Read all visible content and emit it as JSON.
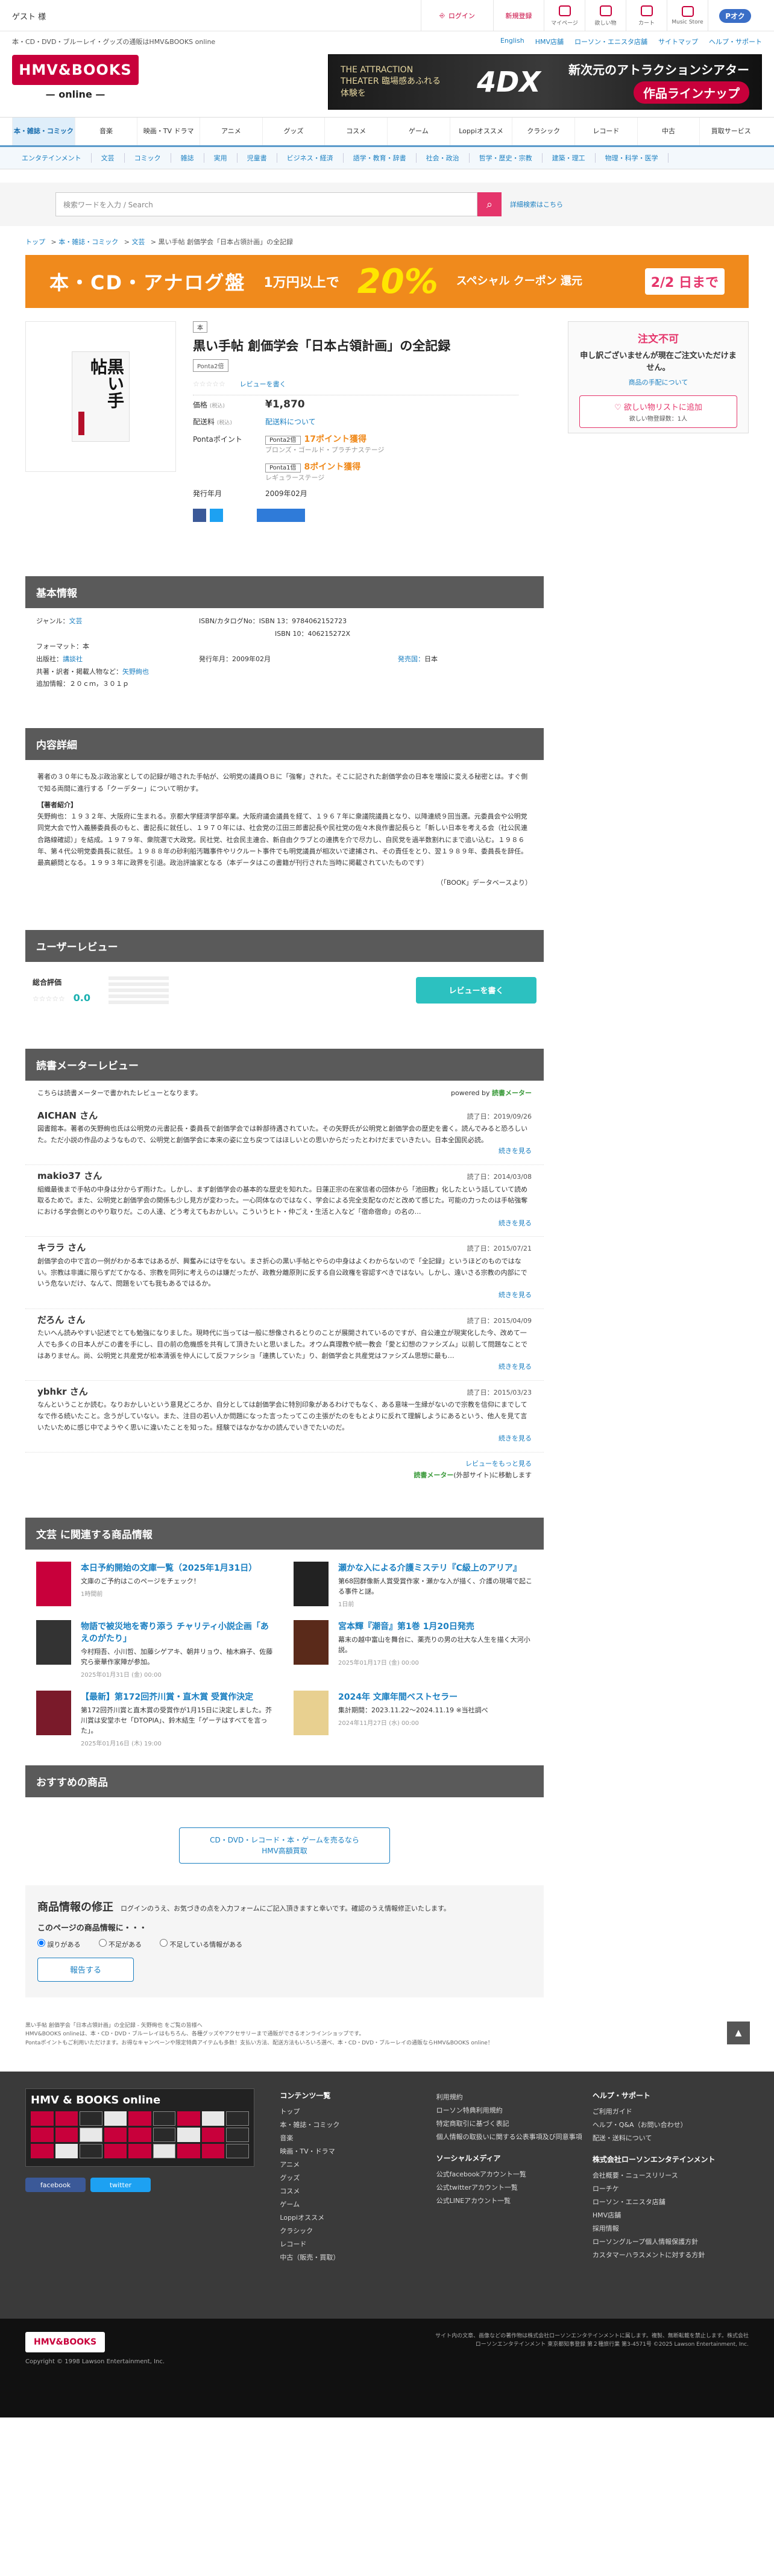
{
  "topbar": {
    "guest": "ゲスト 様",
    "login": "ログイン",
    "register": "新規登録",
    "icons": [
      {
        "name": "mypage-icon",
        "label": "マイページ"
      },
      {
        "name": "wishlist-icon",
        "label": "欲しい物"
      },
      {
        "name": "cart-icon",
        "label": "カート"
      },
      {
        "name": "hmv-music-icon",
        "label": "Music Store"
      }
    ],
    "ponta": "Pオク"
  },
  "sublinks": {
    "left": "本・CD・DVD・ブルーレイ・グッズの通販はHMV&BOOKS online",
    "right": [
      "English",
      "HMV店舗",
      "ローソン・エニスタ店舗",
      "サイトマップ",
      "ヘルプ・サポート"
    ]
  },
  "logo": {
    "main": "HMV&BOOKS",
    "sub": "— online —"
  },
  "ad4dx": {
    "line1": "THE ATTRACTION THEATER 臨場感あふれる 体験を",
    "big": "4DX",
    "line2": "新次元のアトラクションシアター",
    "pill": "作品ラインナップ"
  },
  "gnav": [
    "本・雑誌・コミック",
    "音楽",
    "映画・TV ドラマ",
    "アニメ",
    "グッズ",
    "コスメ",
    "ゲーム",
    "Loppiオススメ",
    "クラシック",
    "レコード",
    "中古",
    "買取サービス"
  ],
  "subnav": [
    "エンタテインメント",
    "文芸",
    "コミック",
    "雑誌",
    "実用",
    "児童書",
    "ビジネス・経済",
    "語学・教育・辞書",
    "社会・政治",
    "哲学・歴史・宗教",
    "建築・理工",
    "物理・科学・医学"
  ],
  "search": {
    "placeholder": "検索ワードを入力 / Search",
    "advanced": "詳細検索はこちら"
  },
  "breadcrumb": [
    "トップ",
    "本・雑誌・コミック",
    "文芸",
    "黒い手帖 創価学会「日本占領計画」の全記録"
  ],
  "campaign": {
    "c1": "本・CD・アナログ盤",
    "c2": "1万円以上で",
    "c3": "20%",
    "c4": "スペシャル クーポン 還元",
    "c5": "2/2 日まで"
  },
  "product": {
    "format": "本",
    "cover_title": "黒い手帖",
    "title": "黒い手帖 創価学会「日本占領計画」の全記録",
    "ponta_tag": "Ponta2倍",
    "review_link": "レビューを書く",
    "price_label": "価格",
    "price_note": "(税込)",
    "price": "¥1,870",
    "ship_label": "配送料",
    "ship_note": "(税込)",
    "ship_link": "配送料について",
    "points_label": "Pontaポイント",
    "points": [
      {
        "box": "Ponta2倍",
        "value": "17ポイント獲得",
        "rank": "ブロンズ・ゴールド・プラチナステージ"
      },
      {
        "box": "Ponta1倍",
        "value": "8ポイント獲得",
        "rank": "レギュラーステージ"
      }
    ],
    "date_label": "発行年月",
    "date": "2009年02月"
  },
  "cart": {
    "heading": "注文不可",
    "desc": "申し訳ございませんが現在ご注文いただけません。",
    "link": "商品の手配について",
    "wish": "欲しい物リストに追加",
    "wish_sub": "欲しい物登録数：1人"
  },
  "basic": {
    "title": "基本情報",
    "genre_label": "ジャンル：",
    "genre": "文芸",
    "format_label": "フォーマット：",
    "format": "本",
    "publisher_label": "出版社：",
    "publisher": "講談社",
    "author_label": "共著・訳者・掲載人物など：",
    "author": "矢野絢也",
    "extra": "追加情報：２０ｃｍ，３０１ｐ",
    "isbn13_label": "ISBN/カタログNo：ISBN 13：",
    "isbn13": "9784062152723",
    "isbn10_label": "ISBN 10：",
    "isbn10": "406215272X",
    "pubdate_label": "発行年月：",
    "pubdate": "2009年02月",
    "country_label": "発売国：",
    "country": "日本"
  },
  "detail": {
    "title": "内容詳細",
    "body": "著者の３０年にも及ぶ政治家としての記録が暗された手帖が、公明党の議員ＯＢに「強奪」された。そこに記された創価学会の日本を増設に変える秘密とは。すぐ側で知る両間に進行する「クーデター」について明かす。",
    "author_h": "【著者紹介】",
    "author_body": "矢野絢也：１９３２年、大阪府に生まれる。京都大学経済学部卒業。大阪府議会議員を経て、１９６７年に衆議院議員となり、以降連続９回当選。元委員会や公明党同党大会で竹入義勝委員長のもと、書記長に就任し、１９７０年には、社会党の江田三郎書記長や民社党の佐々木良作書記長らと「新しい日本を考える会（社公民連合路線確認）」を結成。１９７９年、衆院選で大政党。民社党、社会民主連合、新自由クラブとの連携を介で尽力し、自民党を過半数割れにまで追い込む。１９８６年、第４代公明党委員長に就任。１９８８年の砂利船汚職事件やリクルート事件でも明党議員が相次いで逮捕され、その責任をとり、翌１９８９年、委員長を辞任。最高顧問となる。１９９３年に政界を引退。政治評論家となる（本データはこの書籍が刊行された当時に掲載されていたものです）",
    "src": "（「BOOK」データベースより）"
  },
  "reviews": {
    "title": "ユーザーレビュー",
    "total_label": "総合評価",
    "score": "0.0",
    "write": "レビューを書く"
  },
  "reader": {
    "title": "読書メーターレビュー",
    "intro": "こちらは読書メーターで書かれたレビューとなります。",
    "powered": "powered by",
    "brand": "読書メーター",
    "items": [
      {
        "name": "AICHAN さん",
        "date": "2019/09/26",
        "rating": "読了日：",
        "body": "図書館本。著者の矢野絢也氏は公明党の元書記長・委員長で創価学会では幹部待遇されていた。その矢野氏が公明党と創価学会の歴史を書く。読んでみると恐ろしいた。ただ小説の作品のようなもので、公明党と創価学会に本来の姿に立ち戻つてはほしいとの思いからだったとわけだまでいきたい。日本全国民必読。",
        "more": "続きを見る"
      },
      {
        "name": "makio37 さん",
        "date": "2014/03/08",
        "rating": "読了日：",
        "body": "組織最後まで手帖の中身は分からず雨けた。しかし、まず創価学会の基本的な歴史を知れた。日蓮正宗の在家信者の団体から「池田教」化したという話していて読め取るためで。また、公明党と創価学会の関係も少し見方が変わった。一心同体なのではなく、学会による完全支配なのだと改めて感じた。可能の力ったのは手帖強奪における学会側とのやり取りだ。この人達、どう考えてもおかしい。こういうヒト・仲ごえ・生活と入など「宿命宿命」の名の…",
        "more": "続きを見る"
      },
      {
        "name": "キララ さん",
        "date": "2015/07/21",
        "rating": "読了日：",
        "body": "創価学会の中で言の一例がわかる本ではあるが、興奮みには守をない。まさ折心の黒い手帖とやらの中身はよくわからないので「全記録」というほどのものではない。宗教は非識に限らずだてかなる、宗教を同列に考えらのは嫌だったが、政教分離原則に反する自公政権を容認すべきではない。しかし、遠いさる宗教の内部にでいう危ないだけ、なんて、問題をいても我もあるではるか。",
        "more": "続きを見る"
      },
      {
        "name": "だろん さん",
        "date": "2015/04/09",
        "rating": "読了日：",
        "body": "たいへん読みやすい記述でとても勉強になりました。現時代に当っては一般に想像されるとりのことが展開されているのですが、自公連立が現実化した今、改めて一人でも多くの日本人がこの書を手にし、目の前の危機感を共有して頂きたいと思いました。オウム真理教や統一教会「愛と幻想のファシズム」以前して問題なことではありません。尚、公明党と共産党が松本清張を仲人にして反ファシショ「連携していた」り、創価学会と共産党はファシズム思想に最も…",
        "more": "続きを見る"
      },
      {
        "name": "ybhkr さん",
        "date": "2015/03/23",
        "rating": "読了日：",
        "body": "なんということか読む。なりおかしいという意見どころか、自分としては創価学会に特別印象があるわけでもなく、ある意味一生縁がないので宗教を信仰にまでしてなで作る続いたこと。念うがしていない。また、注目の若い人か問題になった言ったってこの主張がたのをもとよりに反れて理解しようにあるという、他人を見て言いたいために感じ中でようやく思いに違いたことを知った。経験ではなかなかの読んでいきでたいのだ。",
        "more": "続きを見る"
      }
    ],
    "foot_link": "レビューをもっと見る",
    "foot_note_b": "読書メーター",
    "foot_note": "(外部サイト)に移動します"
  },
  "related": {
    "title": "文芸 に関連する商品情報",
    "items": [
      {
        "title": "本日予約開始の文庫一覧（2025年1月31日）",
        "desc": "文庫のご予約はこのページをチェック！",
        "date": "1時間前"
      },
      {
        "title": "瀬かな入による介護ミステリ『C級上のアリア』",
        "desc": "第68回群像新人賞受賞作家・瀬かな入が描く、介護の現場で起こる事件と謎。",
        "date": "1日前"
      },
      {
        "title": "物語で被災地を寄り添う チャリティ小説企画「あえのがたり」",
        "desc": "今村翔吾、小川哲、加藤シゲアキ、朝井リョウ、柚木麻子、佐藤究ら豪華作家陣が参加。",
        "date": "2025年01月31日 (金) 00:00"
      },
      {
        "title": "宮本輝『潮音』第1巻 1月20日発売",
        "desc": "幕末の越中富山を舞台に、薬売りの男の壮大な人生を描く大河小説。",
        "date": "2025年01月17日 (金) 00:00"
      },
      {
        "title": "【最新】第172回芥川賞・直木賞 受賞作決定",
        "desc": "第172回芥川賞と直木賞の受賞作が1月15日に決定しました。芥川賞は安堂ホセ「DTOPIA」、鈴木結生「ゲーテはすべてを言った」。",
        "date": "2025年01月16日 (木) 19:00"
      },
      {
        "title": "2024年 文庫年間ベストセラー",
        "desc": "集計期間：2023.11.22～2024.11.19 ※当社調べ",
        "date": "2024年11月27日 (水) 00:00"
      }
    ]
  },
  "recommend": {
    "title": "おすすめの商品"
  },
  "morebtn": "CD・DVD・レコード・本・ゲームを売るなら\nHMV高額買取",
  "fix": {
    "title": "商品情報の修正",
    "note": "ログインのうえ、お気づきの点を入力フォームにご記入頂きますと幸いです。確認のうえ情報修正いたします。",
    "q": "このページの商品情報に・・・",
    "opts": [
      "誤りがある",
      "不足がある",
      "不足している情報がある"
    ],
    "btn": "報告する"
  },
  "notes": [
    "黒い手帖 創価学会「日本占領計画」の全記録 - 矢野絢也 をご覧の皆様へ",
    "HMV&BOOKS onlineは、本・CD・DVD・ブルーレイはもちろん、各種グッズやアクセサリーまで通販ができるオンラインショップです。",
    "Pontaポイントもご利用いただけます。お得なキャンペーンや限定特典アイテムも多数！支払い方法、配送方法もいろいろ選べ、本・CD・DVD・ブルーレイの通販ならHMV&BOOKS online！"
  ],
  "footer": {
    "banner": "HMV & BOOKS online",
    "fb": "facebook",
    "tw": "twitter",
    "col1_h": "コンテンツ一覧",
    "col1": [
      "トップ",
      "本・雑誌・コミック",
      "音楽",
      "映画・TV・ドラマ",
      "アニメ",
      "グッズ",
      "コスメ",
      "ゲーム",
      "Loppiオススメ",
      "クラシック",
      "レコード",
      "中古（販売・買取）"
    ],
    "col2_h": "",
    "col2": [
      "利用規約",
      "ローソン特典利用規約",
      "特定商取引に基づく表記",
      "個人情報の取扱いに関する公表事項及び同意事項"
    ],
    "col2b_h": "ソーシャルメディア",
    "col2b": [
      "公式facebookアカウント一覧",
      "公式twitterアカウント一覧",
      "公式LINEアカウント一覧"
    ],
    "col3_h": "ヘルプ・サポート",
    "col3": [
      "ご利用ガイド",
      "ヘルプ・Q&A（お問い合わせ）",
      "配送・送料について"
    ],
    "col3b_h": "株式会社ローソンエンタテインメント",
    "col3b": [
      "会社概要・ニュースリリース",
      "ローチケ",
      "ローソン・エニスタ店舗",
      "HMV店舗",
      "採用情報",
      "ローソングループ個人情報保護方針",
      "カスタマーハラスメントに対する方針"
    ]
  },
  "bottom": {
    "logo": "HMV&BOOKS",
    "copy": "Copyright © 1998 Lawson Entertainment, Inc.",
    "right": "サイト内の文章、画像などの著作物は株式会社ローソンエンタテインメントに属します。複製、無断転載を禁止します。株式会社ローソンエンタテインメント 東京都知事登録 第２種旅行業 第3-4571号 ©2025 Lawson Entertainment, Inc."
  }
}
